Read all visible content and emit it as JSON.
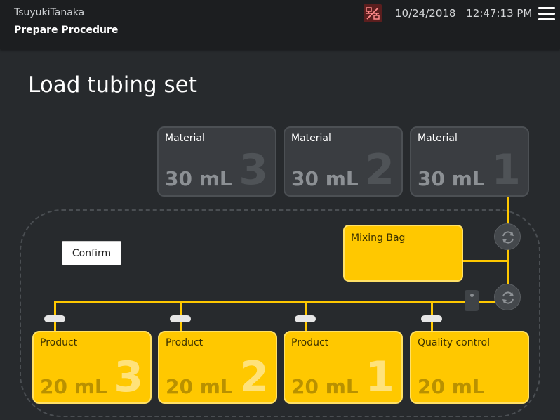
{
  "header": {
    "user_name": "TsuyukiTanaka",
    "procedure": "Prepare Procedure",
    "date": "10/24/2018",
    "time": "12:47:13 PM",
    "network_status_icon": "network-disconnected-icon",
    "menu_icon": "hamburger-menu-icon"
  },
  "page": {
    "title": "Load tubing set"
  },
  "materials": [
    {
      "label": "Material",
      "volume": "30 mL",
      "number": "3"
    },
    {
      "label": "Material",
      "volume": "30 mL",
      "number": "2"
    },
    {
      "label": "Material",
      "volume": "30 mL",
      "number": "1"
    }
  ],
  "mixing_bag": {
    "label": "Mixing Bag"
  },
  "confirm_button": {
    "label": "Confirm"
  },
  "products": [
    {
      "label": "Product",
      "volume": "20 mL",
      "number": "3"
    },
    {
      "label": "Product",
      "volume": "20 mL",
      "number": "2"
    },
    {
      "label": "Product",
      "volume": "20 mL",
      "number": "1"
    },
    {
      "label": "Quality control",
      "volume": "20 mL",
      "number": ""
    }
  ],
  "colors": {
    "accent": "#ffc800",
    "background": "#272a2d",
    "header": "#1c1e20",
    "material_tile": "#3a3d41",
    "disconnected": "#5b1e1e"
  }
}
